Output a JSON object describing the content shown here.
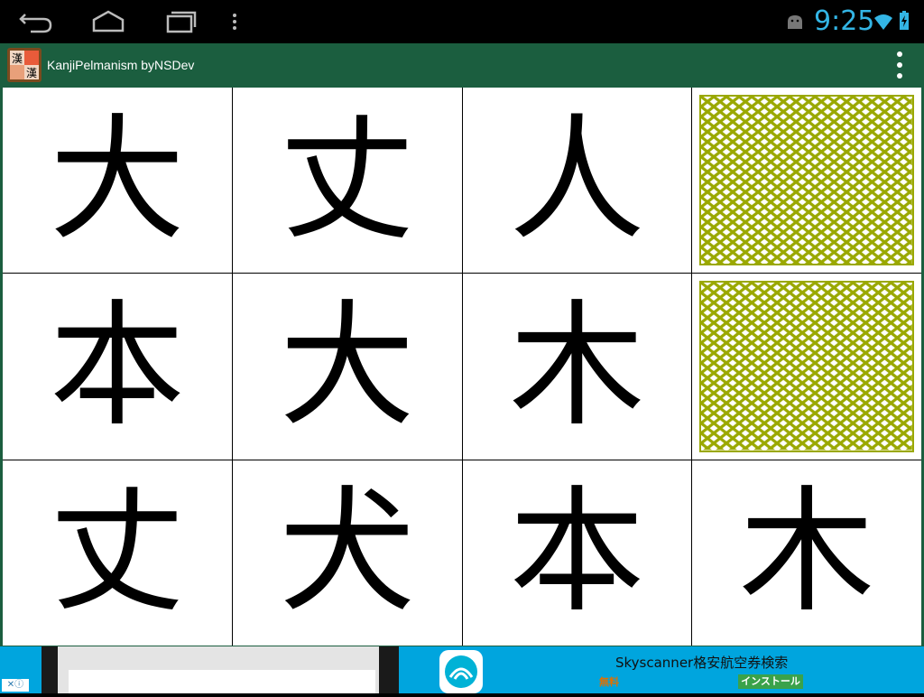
{
  "system_bar": {
    "time": "9:25",
    "icons": [
      "back-icon",
      "home-icon",
      "recent-apps-icon",
      "menu-icon",
      "android-icon",
      "wifi-icon",
      "battery-icon"
    ],
    "time_color": "#33b5e5"
  },
  "app_bar": {
    "title": "KanjiPelmanism byNSDev",
    "app_icon_glyphs": [
      "漢",
      "漢"
    ],
    "background": "#1b5e3f"
  },
  "board": {
    "cards": [
      {
        "state": "face-up",
        "kanji": "大"
      },
      {
        "state": "face-up",
        "kanji": "丈"
      },
      {
        "state": "face-up",
        "kanji": "人"
      },
      {
        "state": "face-down",
        "kanji": ""
      },
      {
        "state": "face-up",
        "kanji": "本"
      },
      {
        "state": "face-up",
        "kanji": "大"
      },
      {
        "state": "face-up",
        "kanji": "木"
      },
      {
        "state": "face-down",
        "kanji": ""
      },
      {
        "state": "face-up",
        "kanji": "丈"
      },
      {
        "state": "face-up",
        "kanji": "犬"
      },
      {
        "state": "face-up",
        "kanji": "本"
      },
      {
        "state": "face-up",
        "kanji": "木"
      }
    ],
    "card_back_color": "#9aa800"
  },
  "ad": {
    "title": "Skyscanner格安航空券検索",
    "price_label": "無料",
    "install_label": "インストール",
    "background": "#00a5de"
  }
}
